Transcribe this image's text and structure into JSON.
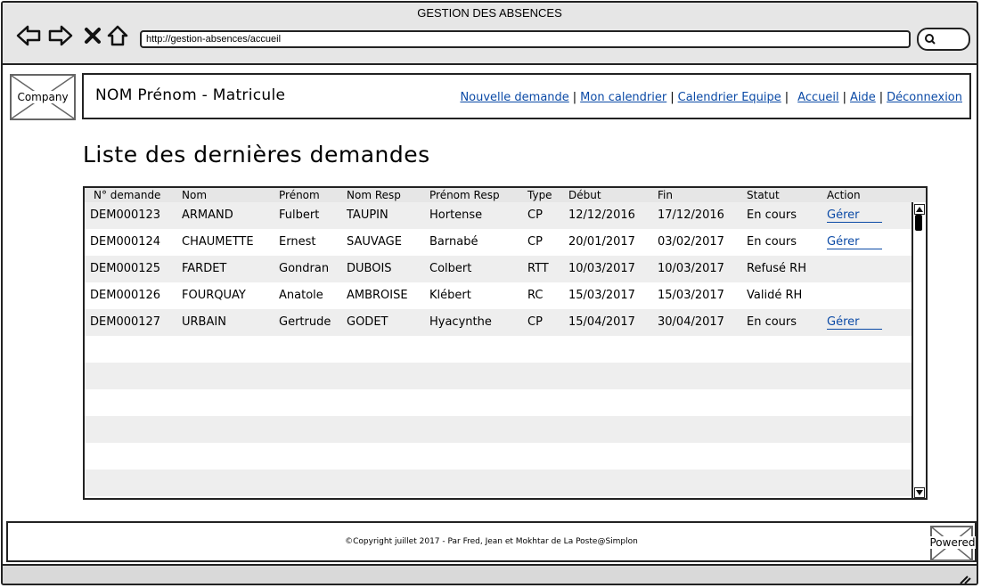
{
  "window": {
    "title": "GESTION DES ABSENCES"
  },
  "browser": {
    "url": "http://gestion-absences/accueil",
    "icons": [
      "back-icon",
      "forward-icon",
      "close-icon",
      "home-icon",
      "search-icon"
    ]
  },
  "header": {
    "logo_label": "Company",
    "user_info": "NOM Prénom - Matricule",
    "nav": [
      {
        "label": "Nouvelle demande"
      },
      {
        "label": "Mon calendrier"
      },
      {
        "label": "Calendrier Equipe"
      },
      {
        "label": "Accueil"
      },
      {
        "label": "Aide"
      },
      {
        "label": "Déconnexion"
      }
    ],
    "nav_separator": "|"
  },
  "main": {
    "title": "Liste des dernières demandes",
    "table": {
      "columns": [
        "N° demande",
        "Nom",
        "Prénom",
        "Nom Resp",
        "Prénom Resp",
        "Type",
        "Début",
        "Fin",
        "Statut",
        "Action"
      ],
      "rows": [
        {
          "id": "DEM000123",
          "nom": "ARMAND",
          "prenom": "Fulbert",
          "nom_resp": "TAUPIN",
          "prenom_resp": "Hortense",
          "type": "CP",
          "debut": "12/12/2016",
          "fin": "17/12/2016",
          "statut": "En cours",
          "action": "Gérer"
        },
        {
          "id": "DEM000124",
          "nom": "CHAUMETTE",
          "prenom": "Ernest",
          "nom_resp": "SAUVAGE",
          "prenom_resp": "Barnabé",
          "type": "CP",
          "debut": "20/01/2017",
          "fin": "03/02/2017",
          "statut": "En cours",
          "action": "Gérer"
        },
        {
          "id": "DEM000125",
          "nom": "FARDET",
          "prenom": "Gondran",
          "nom_resp": "DUBOIS",
          "prenom_resp": "Colbert",
          "type": "RTT",
          "debut": "10/03/2017",
          "fin": "10/03/2017",
          "statut": "Refusé RH",
          "action": ""
        },
        {
          "id": "DEM000126",
          "nom": "FOURQUAY",
          "prenom": "Anatole",
          "nom_resp": "AMBROISE",
          "prenom_resp": "Klébert",
          "type": "RC",
          "debut": "15/03/2017",
          "fin": "15/03/2017",
          "statut": "Validé RH",
          "action": ""
        },
        {
          "id": "DEM000127",
          "nom": "URBAIN",
          "prenom": "Gertrude",
          "nom_resp": "GODET",
          "prenom_resp": "Hyacynthe",
          "type": "CP",
          "debut": "15/04/2017",
          "fin": "30/04/2017",
          "statut": "En cours",
          "action": "Gérer"
        },
        {
          "id": "",
          "nom": "",
          "prenom": "",
          "nom_resp": "",
          "prenom_resp": "",
          "type": "",
          "debut": "",
          "fin": "",
          "statut": "",
          "action": ""
        },
        {
          "id": "",
          "nom": "",
          "prenom": "",
          "nom_resp": "",
          "prenom_resp": "",
          "type": "",
          "debut": "",
          "fin": "",
          "statut": "",
          "action": ""
        },
        {
          "id": "",
          "nom": "",
          "prenom": "",
          "nom_resp": "",
          "prenom_resp": "",
          "type": "",
          "debut": "",
          "fin": "",
          "statut": "",
          "action": ""
        },
        {
          "id": "",
          "nom": "",
          "prenom": "",
          "nom_resp": "",
          "prenom_resp": "",
          "type": "",
          "debut": "",
          "fin": "",
          "statut": "",
          "action": ""
        },
        {
          "id": "",
          "nom": "",
          "prenom": "",
          "nom_resp": "",
          "prenom_resp": "",
          "type": "",
          "debut": "",
          "fin": "",
          "statut": "",
          "action": ""
        },
        {
          "id": "",
          "nom": "",
          "prenom": "",
          "nom_resp": "",
          "prenom_resp": "",
          "type": "",
          "debut": "",
          "fin": "",
          "statut": "",
          "action": ""
        },
        {
          "id": "",
          "nom": "",
          "prenom": "",
          "nom_resp": "",
          "prenom_resp": "",
          "type": "",
          "debut": "",
          "fin": "",
          "statut": "",
          "action": ""
        }
      ]
    }
  },
  "footer": {
    "copyright": "©Copyright juillet 2017 - Par Fred, Jean et Mokhtar de La Poste@Simplon",
    "powered_label": "Powered"
  },
  "colors": {
    "link": "#0b4aa6",
    "row_alt": "#eeeeee",
    "chrome": "#e6e6e6"
  }
}
